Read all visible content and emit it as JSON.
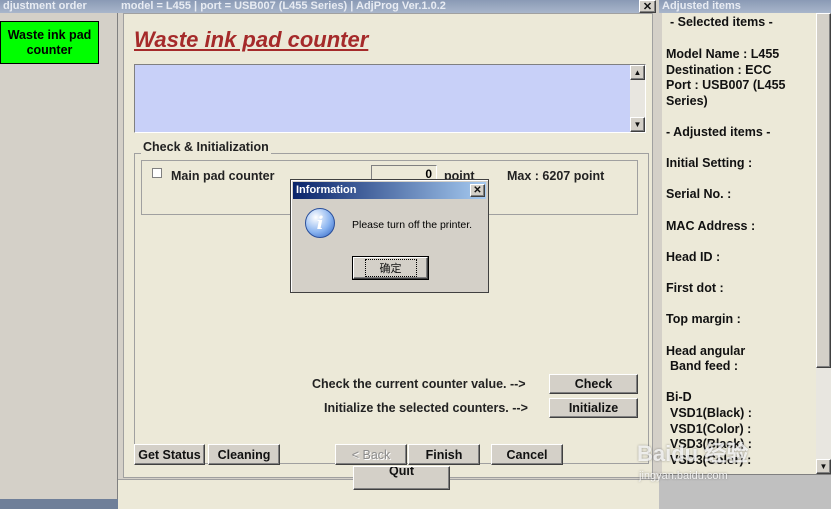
{
  "left_panel": {
    "title": "djustment order",
    "selected_item": "Waste ink pad counter"
  },
  "main_window": {
    "title": "model = L455 | port = USB007 (L455 Series) | AdjProg Ver.1.0.2",
    "heading": "Waste ink pad counter",
    "group_title": "Check & Initialization",
    "main_pad_label": "Main pad counter",
    "counter_value": "0",
    "point_unit": "point",
    "max_label": "Max : 6207 point",
    "check_text": "Check the current counter value. -->",
    "check_button": "Check",
    "init_text": "Initialize the selected counters. -->",
    "init_button": "Initialize",
    "buttons": {
      "get_status": "Get Status",
      "cleaning": "Cleaning",
      "back": "< Back",
      "finish": "Finish",
      "cancel": "Cancel",
      "quit": "Quit"
    }
  },
  "dialog": {
    "title": "Information",
    "message": "Please turn off the printer.",
    "ok": "确定"
  },
  "right_panel": {
    "title": "Adjusted items",
    "selected_header": "- Selected items -",
    "model_name": "Model Name : L455",
    "destination": "Destination : ECC",
    "port_line1": "Port : USB007 (L455",
    "port_line2": "Series)",
    "adjusted_header": "- Adjusted items -",
    "initial_setting": "Initial Setting :",
    "serial_no": "Serial No. :",
    "mac_address": "MAC Address :",
    "head_id": "Head ID :",
    "first_dot": "First dot :",
    "top_margin": "Top margin :",
    "head_angular": "Head angular",
    "band_feed": "Band feed :",
    "bid": "Bi-D",
    "vsd1_black": "VSD1(Black) :",
    "vsd1_color": "VSD1(Color) :",
    "vsd3_black": "VSD3(Black) :",
    "vsd3_color": "VSD3(Color) :"
  },
  "watermark": {
    "brand": "Baidu 经验",
    "url": "jingyan.baidu.com"
  },
  "colors": {
    "selected_green": "#00ff00",
    "heading_red": "#a52a2a",
    "list_blue": "#c8d0f8"
  }
}
